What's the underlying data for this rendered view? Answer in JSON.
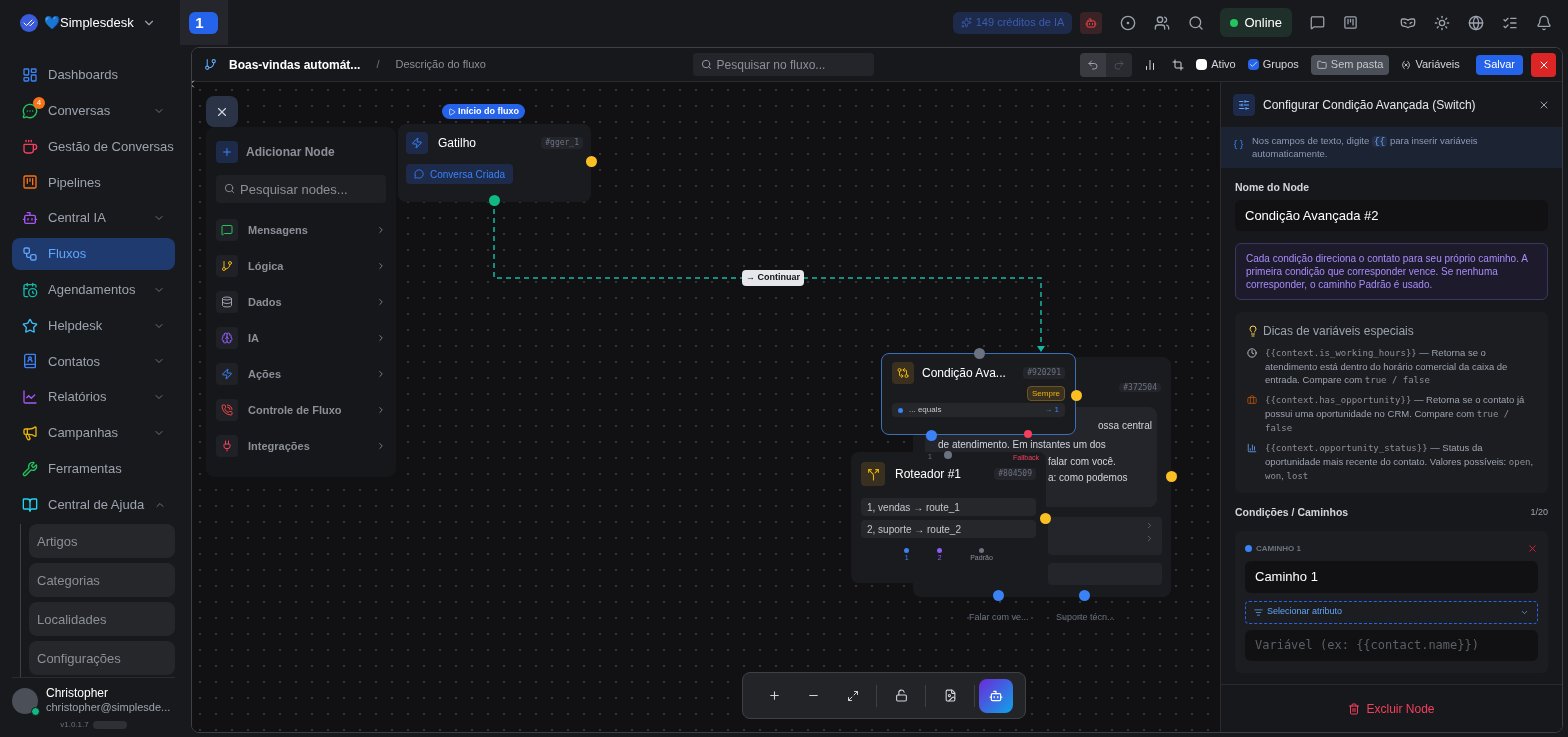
{
  "topbar": {
    "workspace": "💙Simplesdesk",
    "tab_badge": "1",
    "credits": "149 créditos de IA",
    "status": "Online"
  },
  "sidebar": {
    "items": [
      {
        "label": "Dashboards",
        "selected": false
      },
      {
        "label": "Conversas",
        "selected": false,
        "badge": "4",
        "expanded": false
      },
      {
        "label": "Gestão de Conversas",
        "selected": false
      },
      {
        "label": "Pipelines",
        "selected": false
      },
      {
        "label": "Central IA",
        "selected": false,
        "expanded": false
      },
      {
        "label": "Fluxos",
        "selected": true
      },
      {
        "label": "Agendamentos",
        "selected": false,
        "expanded": false
      },
      {
        "label": "Helpdesk",
        "selected": false,
        "expanded": false
      },
      {
        "label": "Contatos",
        "selected": false,
        "expanded": false
      },
      {
        "label": "Relatórios",
        "selected": false,
        "expanded": false
      },
      {
        "label": "Campanhas",
        "selected": false,
        "expanded": false
      },
      {
        "label": "Ferramentas",
        "selected": false
      },
      {
        "label": "Central de Ajuda",
        "selected": false,
        "expanded": true,
        "children": [
          {
            "label": "Artigos"
          },
          {
            "label": "Categorias"
          },
          {
            "label": "Localidades"
          },
          {
            "label": "Configurações"
          }
        ]
      }
    ],
    "user": {
      "name": "Christopher",
      "email": "christopher@simplesde...",
      "online": true
    },
    "version": "v1.0.1.7"
  },
  "flow_toolbar": {
    "title": "Boas-vindas automát...",
    "separator": "/",
    "description": "Descrição do fluxo",
    "search_placeholder": "Pesquisar no fluxo...",
    "checkboxes": [
      {
        "label": "Ativo",
        "checked": false
      },
      {
        "label": "Grupos",
        "checked": true
      }
    ],
    "folder": "Sem pasta",
    "variables": "Variáveis",
    "save": "Salvar"
  },
  "add_node_panel": {
    "title": "Adicionar Node",
    "search_placeholder": "Pesquisar nodes...",
    "categories": [
      {
        "label": "Mensagens"
      },
      {
        "label": "Lógica"
      },
      {
        "label": "Dados"
      },
      {
        "label": "IA"
      },
      {
        "label": "Ações"
      },
      {
        "label": "Controle de Fluxo"
      },
      {
        "label": "Integrações"
      }
    ]
  },
  "canvas": {
    "start_badge": "Início do fluxo",
    "nodes": [
      {
        "kind": "trigger",
        "title": "Gatilho",
        "id": "#gger_1",
        "event": "Conversa Criada"
      },
      {
        "kind": "message",
        "id": "#372504",
        "lines": [
          "ossa central",
          "de atendimento. Em instantes um dos",
          "falar com você.",
          "a: como podemos"
        ],
        "outputs": [
          "Falar com ve...",
          "Suporte técn..."
        ]
      },
      {
        "kind": "condition",
        "title": "Condição Ava...",
        "id": "#920291",
        "badge": "Sempre",
        "rule": "... equals",
        "rule_target": "→ 1",
        "fallback": "Fallback",
        "port": "1"
      },
      {
        "kind": "router",
        "title": "Roteador #1",
        "id": "#804509",
        "routes": [
          "1, vendas → route_1",
          "2, suporte → route_2"
        ],
        "ports": [
          {
            "label": "1",
            "color": "#3b82f6"
          },
          {
            "label": "2",
            "color": "#8b5cf6"
          },
          {
            "label": "Padrão",
            "color": "#6b7280"
          }
        ]
      }
    ],
    "edges": [
      {
        "label": "→ Continuar"
      }
    ]
  },
  "config_panel": {
    "title": "Configurar Condição Avançada (Switch)",
    "hint": {
      "before": "Nos campos de texto, digite",
      "code": "{{",
      "after": "para inserir variáveis automaticamente."
    },
    "name_label": "Nome do Node",
    "name_value": "Condição Avançada #2",
    "info": "Cada condição direciona o contato para seu próprio caminho. A primeira condição que corresponder vence. Se nenhuma corresponder, o caminho Padrão é usado.",
    "tips_title": "Dicas de variáveis especiais",
    "tips": [
      {
        "parts": [
          {
            "kind": "code",
            "text": "{{context.is_working_hours}}"
          },
          {
            "kind": "text",
            "text": " — Retorna se o atendimento está dentro do horário comercial da caixa de entrada. Compare com "
          },
          {
            "kind": "code",
            "text": "true / false"
          }
        ]
      },
      {
        "parts": [
          {
            "kind": "code",
            "text": "{{context.has_opportunity}}"
          },
          {
            "kind": "text",
            "text": " — Retorna se o contato já possui uma oportunidade no CRM. Compare com "
          },
          {
            "kind": "code",
            "text": "true / false"
          }
        ]
      },
      {
        "parts": [
          {
            "kind": "code",
            "text": "{{context.opportunity_status}}"
          },
          {
            "kind": "text",
            "text": " — Status da oportunidade mais recente do contato. Valores possíveis: "
          },
          {
            "kind": "code",
            "text": "open"
          },
          {
            "kind": "text",
            "text": ", "
          },
          {
            "kind": "code",
            "text": "won"
          },
          {
            "kind": "text",
            "text": ", "
          },
          {
            "kind": "code",
            "text": "lost"
          }
        ]
      }
    ],
    "conditions_title": "Condições / Caminhos",
    "conditions_count": "1/20",
    "paths": [
      {
        "label": "CAMINHO 1",
        "color": "#3b82f6",
        "name": "Caminho 1",
        "attribute": "Selecionar atributo",
        "variable_placeholder": "Variável (ex: {{contact.name}})"
      }
    ],
    "delete": "Excluir Node"
  }
}
